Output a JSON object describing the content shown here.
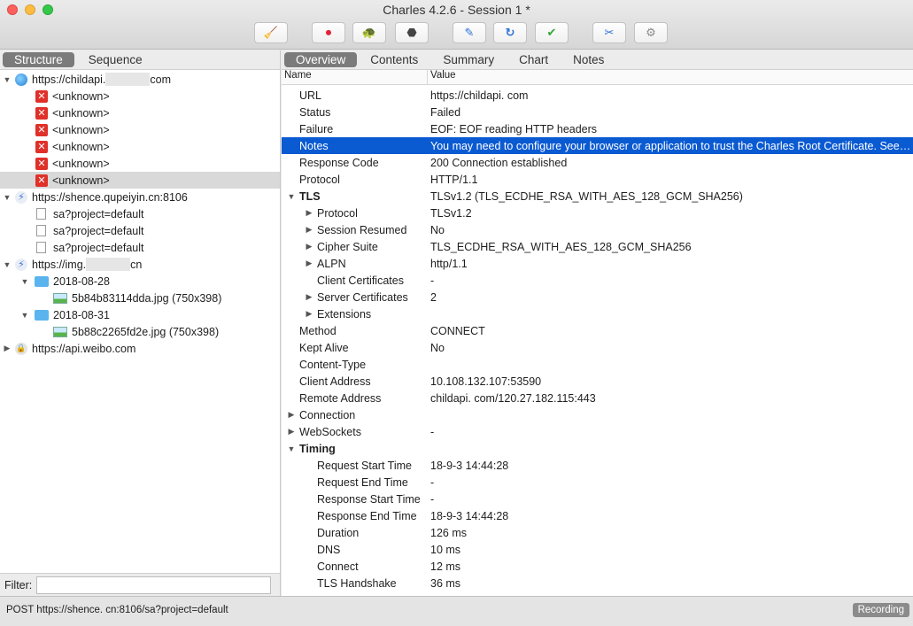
{
  "window": {
    "title": "Charles 4.2.6 - Session 1 *"
  },
  "toolbar": {
    "buttons": [
      {
        "icon": "broom-icon",
        "glyph": "🧹"
      },
      {
        "icon": "record-icon",
        "glyph": "⏺"
      },
      {
        "icon": "throttle-turtle-icon",
        "glyph": "🐢"
      },
      {
        "icon": "breakpoint-stop-icon",
        "glyph": "⬣"
      },
      {
        "icon": "compose-pen-icon",
        "glyph": "✎"
      },
      {
        "icon": "repeat-icon",
        "glyph": "↻"
      },
      {
        "icon": "validate-check-icon",
        "glyph": "✔"
      },
      {
        "icon": "tools-icon",
        "glyph": "✂"
      },
      {
        "icon": "settings-gear-icon",
        "glyph": "⚙"
      }
    ]
  },
  "left": {
    "tabs": [
      "Structure",
      "Sequence"
    ],
    "tree": {
      "host1": {
        "prefix": "https://childapi.",
        "suffix": "com"
      },
      "host1_children": [
        "<unknown>",
        "<unknown>",
        "<unknown>",
        "<unknown>",
        "<unknown>",
        "<unknown>"
      ],
      "host2": "https://shence.qupeiyin.cn:8106",
      "host2_children": [
        "sa?project=default",
        "sa?project=default",
        "sa?project=default"
      ],
      "host3": {
        "prefix": "https://img.",
        "suffix": "cn"
      },
      "folder1": "2018-08-28",
      "file1": "5b84b83114dda.jpg (750x398)",
      "folder2": "2018-08-31",
      "file2": "5b88c2265fd2e.jpg (750x398)",
      "host4": "https://api.weibo.com"
    },
    "filter_label": "Filter:",
    "filter_value": ""
  },
  "right": {
    "tabs": [
      "Overview",
      "Contents",
      "Summary",
      "Chart",
      "Notes"
    ],
    "columns": {
      "name": "Name",
      "value": "Value"
    },
    "rows": [
      {
        "name": "URL",
        "value": "https://childapi.            com"
      },
      {
        "name": "Status",
        "value": "Failed"
      },
      {
        "name": "Failure",
        "value": "EOF: EOF reading HTTP headers"
      },
      {
        "name": "Notes",
        "value": "You may need to configure your browser or application to trust the Charles Root Certificate. See SSL Proxying in the Help menu."
      },
      {
        "name": "Response Code",
        "value": "200 Connection established"
      },
      {
        "name": "Protocol",
        "value": "HTTP/1.1"
      },
      {
        "name": "TLS",
        "value": "TLSv1.2 (TLS_ECDHE_RSA_WITH_AES_128_GCM_SHA256)"
      },
      {
        "name": "Protocol",
        "value": "TLSv1.2"
      },
      {
        "name": "Session Resumed",
        "value": "No"
      },
      {
        "name": "Cipher Suite",
        "value": "TLS_ECDHE_RSA_WITH_AES_128_GCM_SHA256"
      },
      {
        "name": "ALPN",
        "value": "http/1.1"
      },
      {
        "name": "Client Certificates",
        "value": "-"
      },
      {
        "name": "Server Certificates",
        "value": "2"
      },
      {
        "name": "Extensions",
        "value": ""
      },
      {
        "name": "Method",
        "value": "CONNECT"
      },
      {
        "name": "Kept Alive",
        "value": "No"
      },
      {
        "name": "Content-Type",
        "value": ""
      },
      {
        "name": "Client Address",
        "value": "10.108.132.107:53590"
      },
      {
        "name": "Remote Address",
        "value": "childapi.            com/120.27.182.115:443"
      },
      {
        "name": "Connection",
        "value": ""
      },
      {
        "name": "WebSockets",
        "value": "-"
      },
      {
        "name": "Timing",
        "value": ""
      },
      {
        "name": "Request Start Time",
        "value": "18-9-3 14:44:28"
      },
      {
        "name": "Request End Time",
        "value": "-"
      },
      {
        "name": "Response Start Time",
        "value": "-"
      },
      {
        "name": "Response End Time",
        "value": "18-9-3 14:44:28"
      },
      {
        "name": "Duration",
        "value": "126 ms"
      },
      {
        "name": "DNS",
        "value": "10 ms"
      },
      {
        "name": "Connect",
        "value": "12 ms"
      },
      {
        "name": "TLS Handshake",
        "value": "36 ms"
      }
    ]
  },
  "status": {
    "text": "POST https://shence.            cn:8106/sa?project=default",
    "recording": "Recording"
  }
}
